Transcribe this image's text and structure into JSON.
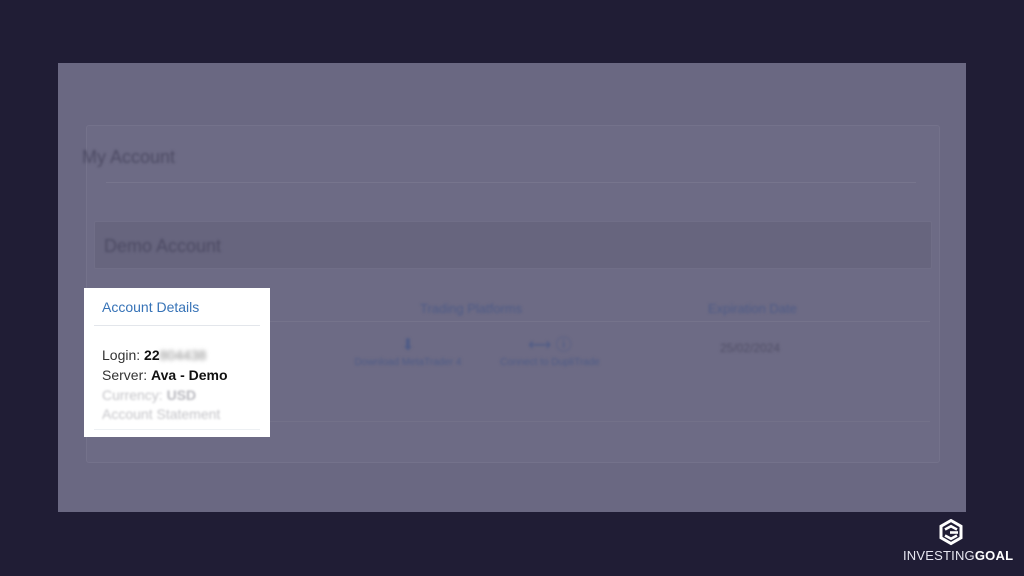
{
  "page": {
    "account_title": "My Account",
    "section_title": "Demo Account",
    "columns": {
      "account_details": "Account Details",
      "trading_platforms": "Trading Platforms",
      "expiration_date": "Expiration Date"
    },
    "platforms": {
      "download": "Download MetaTrader 4",
      "connect": "Connect to DupliTrade"
    },
    "expiration_value": "25/02/2024"
  },
  "details": {
    "login_label": "Login:",
    "login_value": "22",
    "login_hidden": "804438",
    "server_label": "Server:",
    "server_value": "Ava - Demo",
    "currency_label": "Currency:",
    "currency_value": "USD",
    "statement_link": "Account Statement"
  },
  "brand": {
    "prefix": "INVESTING",
    "suffix": "GOAL"
  },
  "colors": {
    "background": "#201d35",
    "overlay": "#6a6882",
    "link": "#3773b7",
    "highlight": "#ffffff"
  },
  "icons": {
    "download": "download-icon",
    "connect": "connect-icon",
    "logo": "investinggoal-logo-icon"
  }
}
